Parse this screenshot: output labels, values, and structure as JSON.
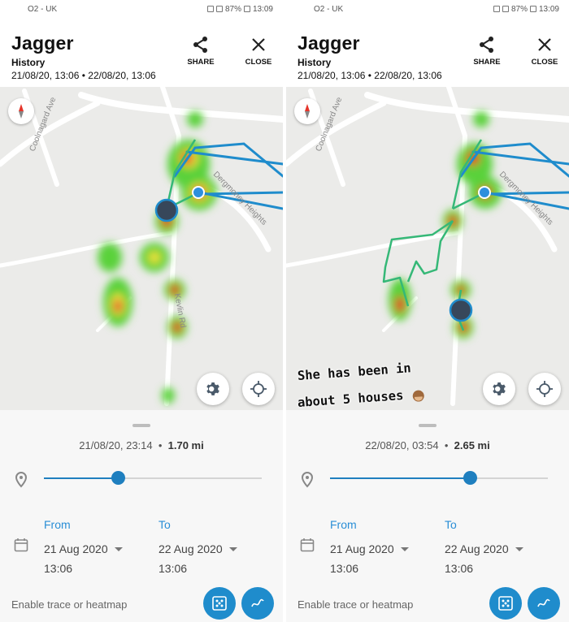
{
  "status_bar": {
    "carrier": "O2 - UK",
    "battery": "87%",
    "time": "13:09"
  },
  "header": {
    "title": "Jagger",
    "subtitle": "History",
    "range": "21/08/20, 13:06 • 22/08/20, 13:06",
    "share_label": "SHARE",
    "close_label": "CLOSE"
  },
  "map": {
    "street_labels": [
      "Coolnagard Ave",
      "Dergmoney Heights",
      "Kevlin Rd"
    ],
    "track_color": "#1f8ccc",
    "heat_colors": [
      "#5ad13b",
      "#e8e03a",
      "#e5342a"
    ]
  },
  "panels": [
    {
      "timestamp": "21/08/20, 23:14",
      "distance": "1.70 mi",
      "slider_fraction": 0.34
    },
    {
      "timestamp": "22/08/20, 03:54",
      "distance": "2.65 mi",
      "slider_fraction": 0.64,
      "caption_line1": "She has been in",
      "caption_line2": "about 5 houses"
    }
  ],
  "controls": {
    "from_label": "From",
    "to_label": "To",
    "from_date": "21 Aug 2020",
    "from_time": "13:06",
    "to_date": "22 Aug 2020",
    "to_time": "13:06",
    "enable_text": "Enable trace or heatmap"
  }
}
